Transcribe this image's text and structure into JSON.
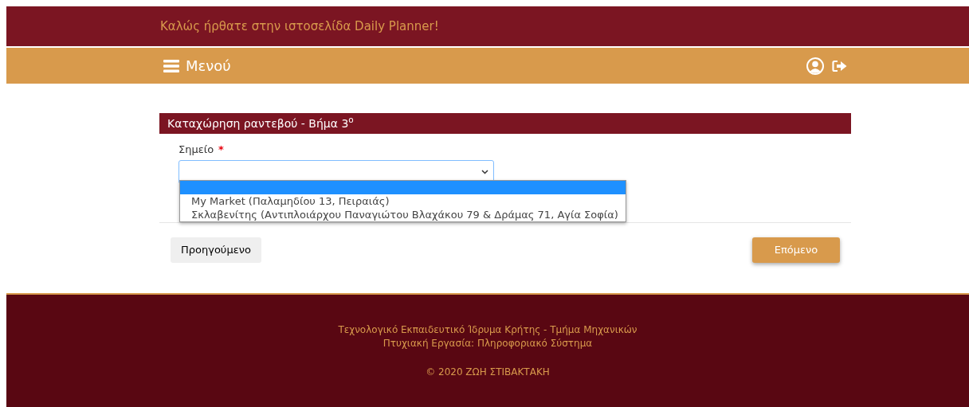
{
  "top_bar": {
    "welcome": "Καλώς ήρθατε στην ιστοσελίδα Daily Planner!"
  },
  "nav_bar": {
    "menu_label": "Μενού"
  },
  "form": {
    "title": "Καταχώρηση ραντεβού - Βήμα 3$^{ο}$",
    "field": {
      "label": "Σημείο",
      "required": true,
      "required_mark": "*",
      "expanded": true
    },
    "options": [
      {
        "selected": true
      },
      {
        "label": "My Market (Παλαμηδίου 13, Πειραιάς)",
        "selected": false
      },
      {
        "label": "Σκλαβενίτης (Αντιπλοιάρχου Παναγιώτου Βλαχάκου 79 & Δράμας 71, Αγία Σοφία)",
        "selected": false
      }
    ],
    "buttons": {
      "previous": "Προηγούμενο",
      "next": "Επόμενο"
    }
  },
  "footer": {
    "lines": [
      "Τεχνολογικό Εκπαιδευτικό Ίδρυμα Κρήτης - Τμήμα Μηχανικών",
      "Πτυχιακή Εργασία: Πληροφοριακό Σύστημα"
    ],
    "copyright": "© 2020 ΖΩΗ ΣΤΙΒΑΚΤΑΚΗ"
  }
}
